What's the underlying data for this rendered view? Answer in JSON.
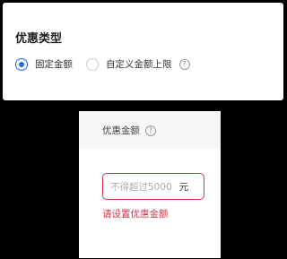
{
  "discount_type": {
    "title": "优惠类型",
    "options": [
      {
        "label": "固定金额",
        "checked": true
      },
      {
        "label": "自定义金额上限",
        "checked": false
      }
    ],
    "help_glyph": "?",
    "help_icon": "question-circle-icon"
  },
  "discount_amount": {
    "label": "优惠金额",
    "help_glyph": "?",
    "help_icon": "question-circle-icon",
    "input_placeholder": "不得超过5000",
    "input_value": "",
    "unit": "元",
    "error_message": "请设置优惠金额"
  },
  "colors": {
    "accent": "#1f6de0",
    "error": "#d0334b"
  }
}
